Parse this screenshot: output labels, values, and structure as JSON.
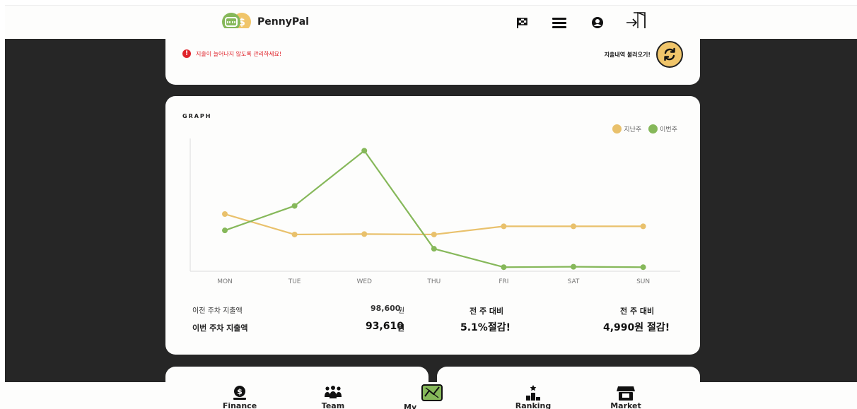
{
  "brand": {
    "name": "PennyPal"
  },
  "header_icons": [
    "flag-icon",
    "menu-icon",
    "user-icon",
    "logout-icon"
  ],
  "summary": {
    "warning": "지출이 늘어나지 않도록 관리하세요!",
    "load_label": "지출내역 불러오기!"
  },
  "graph": {
    "title": "GRAPH",
    "legend": {
      "last_week": "지난주",
      "this_week": "이번주"
    }
  },
  "colors": {
    "last_week": "#e9c16c",
    "this_week": "#86b85a",
    "dark_bg": "#262626",
    "warning": "#e0242b"
  },
  "chart_data": {
    "type": "line",
    "categories": [
      "MON",
      "TUE",
      "WED",
      "THU",
      "FRI",
      "SAT",
      "SUN"
    ],
    "series": [
      {
        "name": "지난주",
        "values": [
          28,
          18,
          18.2,
          18,
          22,
          22,
          22
        ]
      },
      {
        "name": "이번주",
        "values": [
          20,
          32,
          59,
          11,
          2,
          2.2,
          2
        ]
      }
    ],
    "grid": false,
    "legend_position": "top-right"
  },
  "stats": {
    "prev_label": "이전 주차 지출액",
    "prev_value": "98,600",
    "prev_unit": "원",
    "curr_label": "이번 주차 지출액",
    "curr_value": "93,610",
    "curr_unit": "원",
    "cmp1_title": "전 주 대비",
    "cmp1_value": "5.1%절감!",
    "cmp2_title": "전 주 대비",
    "cmp2_value": "4,990원 절감!"
  },
  "bottom_nav": [
    {
      "label": "Finance",
      "icon": "money-bag-icon"
    },
    {
      "label": "Team",
      "icon": "team-icon"
    },
    {
      "label": "My Spending",
      "icon": "spending-icon"
    },
    {
      "label": "Ranking",
      "icon": "ranking-icon"
    },
    {
      "label": "Market",
      "icon": "market-icon"
    }
  ]
}
